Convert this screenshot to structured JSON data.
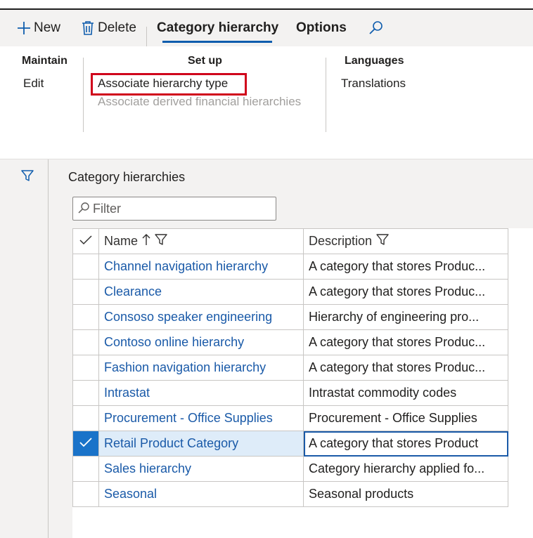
{
  "action_pane": {
    "new_label": "New",
    "delete_label": "Delete",
    "tabs": [
      {
        "label": "Category hierarchy",
        "active": true
      },
      {
        "label": "Options",
        "active": false
      }
    ],
    "search_icon": "search-icon"
  },
  "ribbon": {
    "groups": [
      {
        "title": "Maintain",
        "items": [
          {
            "label": "Edit",
            "enabled": true
          }
        ]
      },
      {
        "title": "Set up",
        "items": [
          {
            "label": "Associate hierarchy type",
            "enabled": true,
            "highlighted": true
          },
          {
            "label": "Associate derived financial hierarchies",
            "enabled": false
          }
        ]
      },
      {
        "title": "Languages",
        "items": [
          {
            "label": "Translations",
            "enabled": true
          }
        ]
      }
    ]
  },
  "filter_pane_icon": "filter-icon",
  "section": {
    "title": "Category hierarchies",
    "filter_placeholder": "Filter"
  },
  "grid": {
    "columns": [
      {
        "label": "Name",
        "sort": "ascending",
        "filter": true
      },
      {
        "label": "Description",
        "filter": true
      }
    ],
    "rows": [
      {
        "name": "Channel navigation hierarchy",
        "description": "A category that stores Produc...",
        "selected": false
      },
      {
        "name": "Clearance",
        "description": "A category that stores Produc...",
        "selected": false
      },
      {
        "name": "Consoso speaker engineering",
        "description": "Hierarchy of engineering pro...",
        "selected": false
      },
      {
        "name": "Contoso online hierarchy",
        "description": "A category that stores Produc...",
        "selected": false
      },
      {
        "name": "Fashion navigation hierarchy",
        "description": "A category that stores Produc...",
        "selected": false
      },
      {
        "name": "Intrastat",
        "description": "Intrastat commodity codes",
        "selected": false
      },
      {
        "name": "Procurement - Office Supplies",
        "description": "Procurement - Office Supplies",
        "selected": false
      },
      {
        "name": "Retail Product Category",
        "description": "A category that stores Product",
        "selected": true
      },
      {
        "name": "Sales hierarchy",
        "description": "Category hierarchy applied fo...",
        "selected": false
      },
      {
        "name": "Seasonal",
        "description": "Seasonal products",
        "selected": false
      }
    ]
  },
  "colors": {
    "accent": "#1a5aa8",
    "highlight_border": "#d0021b",
    "selected_row": "#deecf9"
  }
}
